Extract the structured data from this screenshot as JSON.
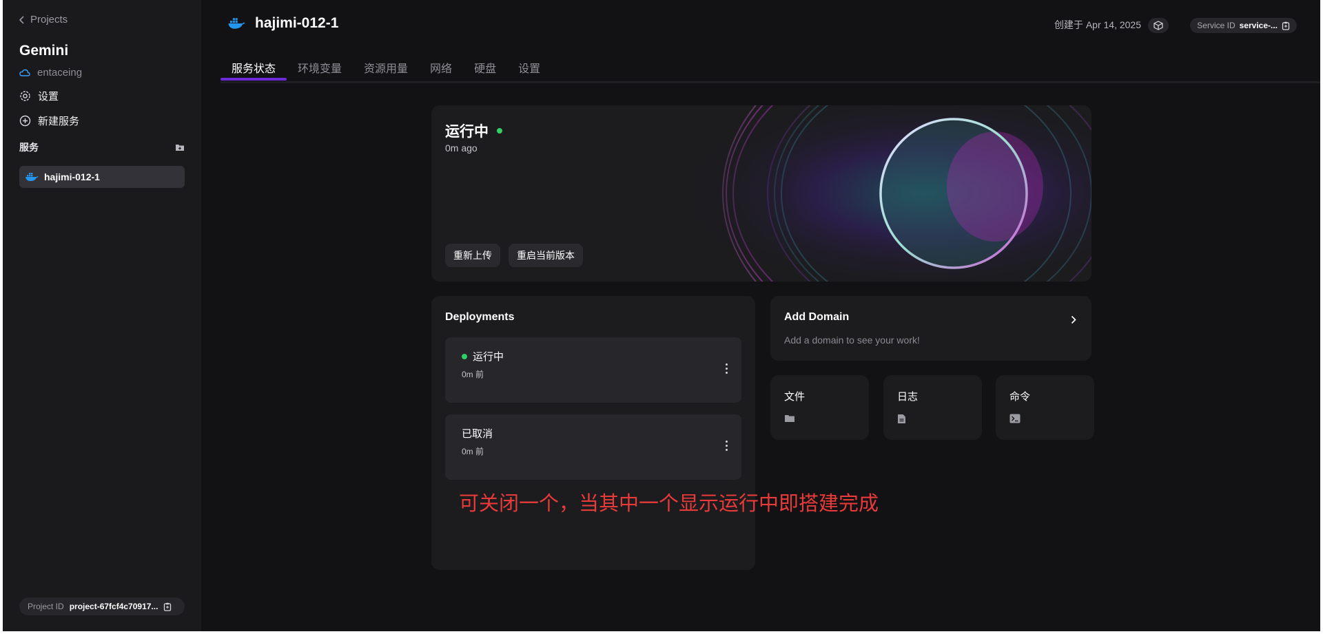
{
  "sidebar": {
    "back_label": "Projects",
    "project_name": "Gemini",
    "workspace": "entaceing",
    "settings_label": "设置",
    "new_service_label": "新建服务",
    "services_header": "服务",
    "services": [
      {
        "label": "hajimi-012-1",
        "icon": "docker-icon"
      }
    ],
    "project_id_label": "Project ID",
    "project_id_value": "project-67fcf4c70917..."
  },
  "header": {
    "service_title": "hajimi-012-1",
    "created": "创建于 Apr 14, 2025",
    "service_id_label": "Service ID",
    "service_id_value": "service-..."
  },
  "tabs": [
    {
      "label": "服务状态",
      "active": true
    },
    {
      "label": "环境变量",
      "active": false
    },
    {
      "label": "资源用量",
      "active": false
    },
    {
      "label": "网络",
      "active": false
    },
    {
      "label": "硬盘",
      "active": false
    },
    {
      "label": "设置",
      "active": false
    }
  ],
  "hero": {
    "status": "运行中",
    "status_color": "#2fd065",
    "time": "0m ago",
    "buttons": [
      "重新上传",
      "重启当前版本"
    ]
  },
  "deployments": {
    "title": "Deployments",
    "items": [
      {
        "status": "运行中",
        "running": true,
        "time": "0m 前"
      },
      {
        "status": "已取消",
        "running": false,
        "time": "0m 前"
      }
    ]
  },
  "annotation": "可关闭一个，当其中一个显示运行中即搭建完成",
  "domain": {
    "title": "Add Domain",
    "subtitle": "Add a domain to see your work!"
  },
  "quick_cards": [
    {
      "label": "文件",
      "icon": "folder-icon"
    },
    {
      "label": "日志",
      "icon": "file-icon"
    },
    {
      "label": "命令",
      "icon": "terminal-icon"
    }
  ],
  "colors": {
    "accent": "#6d2ad9",
    "running": "#2fd065",
    "annotation": "#e93a3a"
  }
}
